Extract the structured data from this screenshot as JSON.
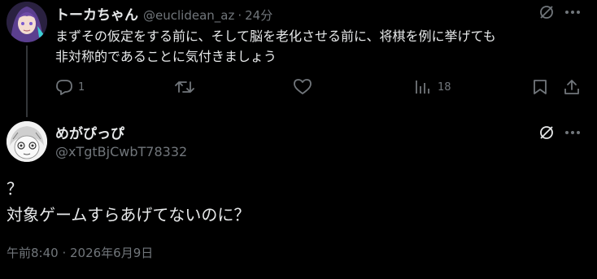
{
  "tweet1": {
    "display_name": "トーカちゃん",
    "handle": "@euclidean_az",
    "separator": "·",
    "time": "24分",
    "text_line1": "まずその仮定をする前に、そして脳を老化させる前に、将棋を例に挙げても",
    "text_line2": "非対称的であることに気付きましょう",
    "reply_count": "1",
    "retweet_count": "",
    "like_count": "",
    "view_count": "18"
  },
  "tweet2": {
    "display_name": "めがぴっぴ",
    "handle": "@xTgtBjCwbT78332",
    "text": "？\n対象ゲームすらあげてないのに？",
    "timestamp": "午前8:40 · 2026年6月9日"
  },
  "icons": {
    "grok": "grok-icon",
    "more": "more-icon",
    "reply": "reply-icon",
    "retweet": "retweet-icon",
    "like": "like-icon",
    "views": "views-icon",
    "bookmark": "bookmark-icon",
    "share": "share-icon"
  },
  "colors": {
    "background": "#000000",
    "text": "#e7e9ea",
    "muted": "#71767b",
    "divider": "#333639"
  }
}
